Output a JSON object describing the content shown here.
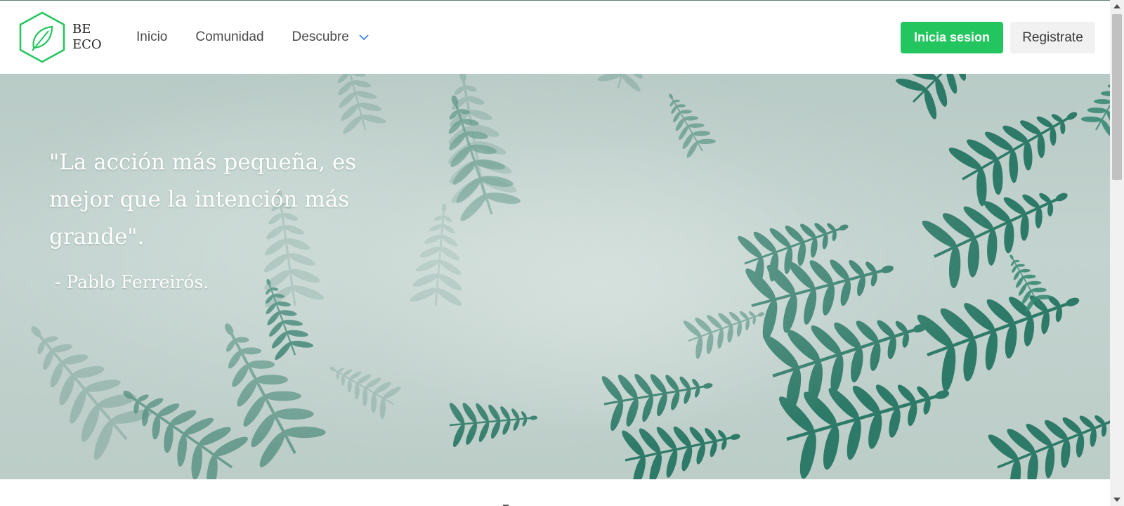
{
  "brand": {
    "line1": "BE",
    "line2": "ECO",
    "icon": "leaf-hexagon-logo-icon"
  },
  "nav": {
    "links": [
      {
        "label": "Inicio"
      },
      {
        "label": "Comunidad"
      },
      {
        "label": "Descubre",
        "icon": "chevron-down-icon"
      }
    ]
  },
  "auth": {
    "login_label": "Inicia sesion",
    "register_label": "Registrate"
  },
  "hero": {
    "quote": "\"La acción más pequeña, es mejor que la intención más grande\".",
    "author": "- Pablo Ferreirós."
  },
  "colors": {
    "accent": "#22c55e",
    "logo_stroke": "#22c55e",
    "chevron": "#3b82f6",
    "hero_bg": "#c3d3cf",
    "fern": "#2e7a68"
  }
}
